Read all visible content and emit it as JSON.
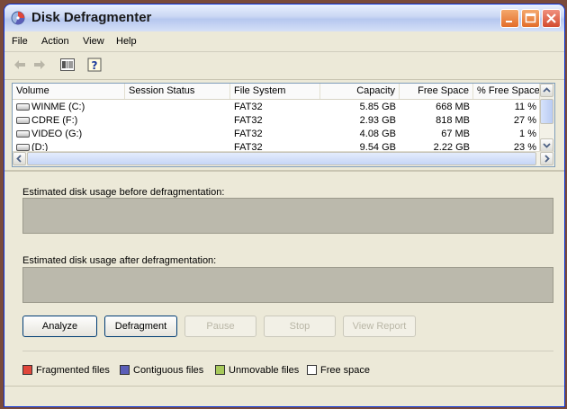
{
  "window": {
    "title": "Disk Defragmenter"
  },
  "menu": [
    "File",
    "Action",
    "View",
    "Help"
  ],
  "toolbar_icons": [
    "back-arrow-icon",
    "forward-arrow-icon",
    "show-hide-console-tree-icon",
    "help-icon"
  ],
  "volumes": {
    "columns": [
      "Volume",
      "Session Status",
      "File System",
      "Capacity",
      "Free Space",
      "% Free Space"
    ],
    "rows": [
      {
        "volume": "WINME (C:)",
        "status": "",
        "fs": "FAT32",
        "capacity": "5.85 GB",
        "free": "668 MB",
        "pct": "11 %"
      },
      {
        "volume": "CDRE (F:)",
        "status": "",
        "fs": "FAT32",
        "capacity": "2.93 GB",
        "free": "818 MB",
        "pct": "27 %"
      },
      {
        "volume": "VIDEO (G:)",
        "status": "",
        "fs": "FAT32",
        "capacity": "4.08 GB",
        "free": "67 MB",
        "pct": "1 %"
      },
      {
        "volume": "(D:)",
        "status": "",
        "fs": "FAT32",
        "capacity": "9.54 GB",
        "free": "2.22 GB",
        "pct": "23 %"
      }
    ]
  },
  "before_label": "Estimated disk usage before defragmentation:",
  "after_label": "Estimated disk usage after defragmentation:",
  "buttons": {
    "analyze": "Analyze",
    "defragment": "Defragment",
    "pause": "Pause",
    "stop": "Stop",
    "view_report": "View Report"
  },
  "legend": [
    {
      "label": "Fragmented files",
      "color": "#E0463A"
    },
    {
      "label": "Contiguous files",
      "color": "#5B5EB8"
    },
    {
      "label": "Unmovable files",
      "color": "#A7C95B"
    },
    {
      "label": "Free space",
      "color": "#FFFFFF"
    }
  ],
  "colors": {
    "titlebar": "#C9D6F3",
    "window_bg": "#ECE9D8",
    "bar_gray": "#BBB9AC"
  }
}
